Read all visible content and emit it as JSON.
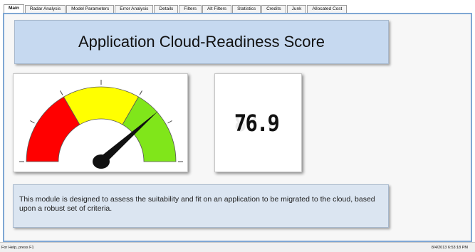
{
  "tabs": [
    {
      "label": "Main",
      "active": true
    },
    {
      "label": "Radar Analysis",
      "active": false
    },
    {
      "label": "Model Parameters",
      "active": false
    },
    {
      "label": "Error Analysis",
      "active": false
    },
    {
      "label": "Details",
      "active": false
    },
    {
      "label": "Filters",
      "active": false
    },
    {
      "label": "Alt Filters",
      "active": false
    },
    {
      "label": "Statistics",
      "active": false
    },
    {
      "label": "Credits",
      "active": false
    },
    {
      "label": "Junk",
      "active": false
    },
    {
      "label": "Allocated Cost",
      "active": false
    }
  ],
  "main": {
    "title": "Application Cloud-Readiness Score",
    "score": "76.9",
    "score_ghost": "88.8",
    "gauge": {
      "value_fraction": 0.769,
      "zones": [
        {
          "name": "red",
          "color": "#ff0000"
        },
        {
          "name": "yellow",
          "color": "#ffff00"
        },
        {
          "name": "green",
          "color": "#80e61a"
        }
      ]
    },
    "description": "This module is designed to assess the suitability and fit on an application to be migrated to the cloud, based upon a robust set of criteria."
  },
  "status": {
    "help_text": "For Help, press F1",
    "datetime": "8/4/2013 6:53:18 PM"
  },
  "colors": {
    "title_bg": "#c6d9f0",
    "desc_bg": "#dbe5f1",
    "sheet_border": "#7fa7d4"
  }
}
